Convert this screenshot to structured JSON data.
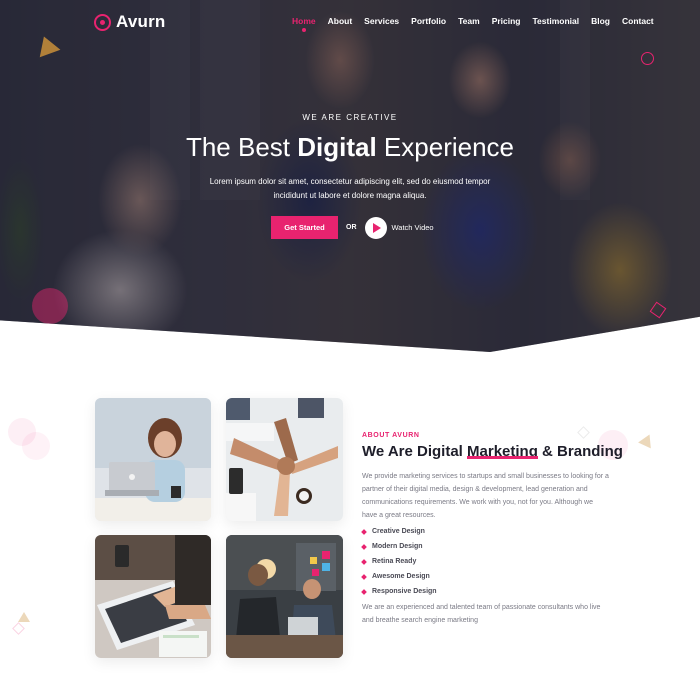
{
  "brand": {
    "name": "Avurn",
    "accent": "#e8236f"
  },
  "nav": {
    "items": [
      {
        "label": "Home",
        "active": true
      },
      {
        "label": "About",
        "active": false
      },
      {
        "label": "Services",
        "active": false
      },
      {
        "label": "Portfolio",
        "active": false
      },
      {
        "label": "Team",
        "active": false
      },
      {
        "label": "Pricing",
        "active": false
      },
      {
        "label": "Testimonial",
        "active": false
      },
      {
        "label": "Blog",
        "active": false
      },
      {
        "label": "Contact",
        "active": false
      }
    ]
  },
  "hero": {
    "eyebrow": "WE ARE CREATIVE",
    "title_before": "The Best ",
    "title_highlight": "Digital",
    "title_after": " Experience",
    "description": "Lorem ipsum dolor sit amet, consectetur adipiscing elit, sed do eiusmod tempor incididunt ut labore et dolore magna aliqua.",
    "primary_button": "Get Started",
    "or_label": "OR",
    "video_label": "Watch Video",
    "play_icon": "play-icon"
  },
  "about": {
    "tag": "ABOUT AVURN",
    "title_before": "We Are Digital ",
    "title_highlight": "Marketing",
    "title_after": " & Branding",
    "paragraph": "We provide marketing services to startups and small businesses to looking for a partner of their digital media, design & development, lead generation and communications requirements. We work with you, not for you. Although we have a great resources.",
    "features": [
      "Creative Design",
      "Modern Design",
      "Retina Ready",
      "Awesome Design",
      "Responsive Design"
    ],
    "paragraph2": "We are an experienced and talented team of passionate consultants who live and breathe search engine marketing",
    "images": [
      "woman-laptop-photo",
      "team-fist-bump-photo",
      "laptop-typing-photo",
      "office-meeting-photo"
    ]
  }
}
